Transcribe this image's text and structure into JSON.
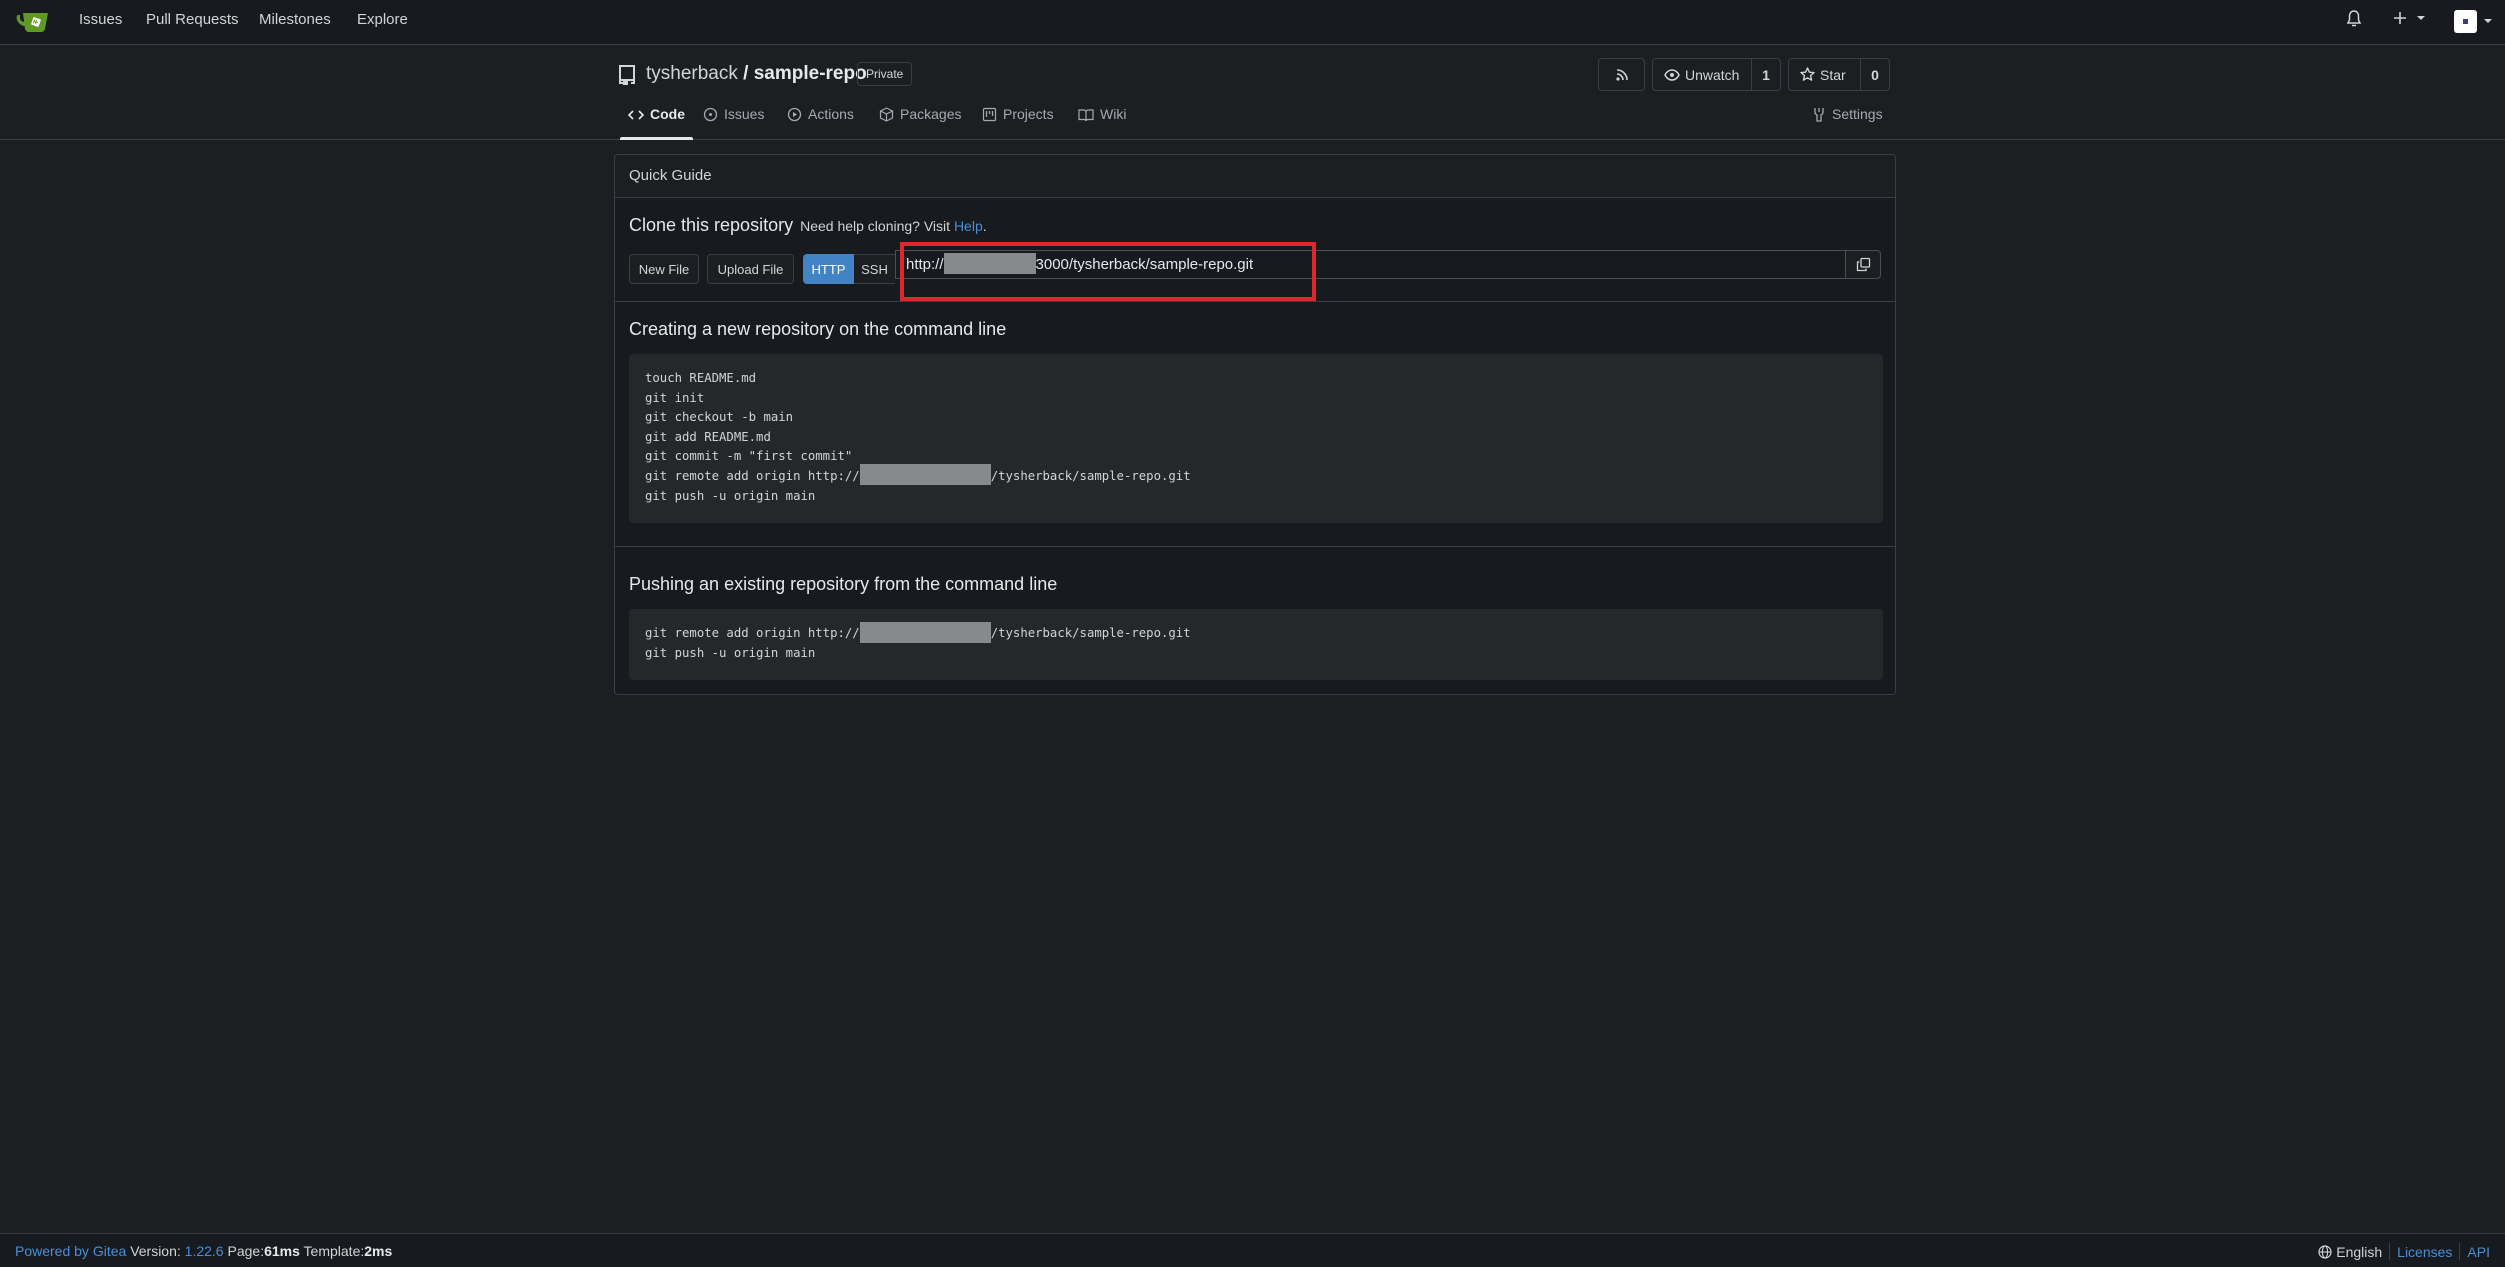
{
  "navbar": {
    "logo": "gitea-logo",
    "items": [
      {
        "label": "Issues"
      },
      {
        "label": "Pull Requests"
      },
      {
        "label": "Milestones"
      },
      {
        "label": "Explore"
      }
    ],
    "right_icons": [
      "bell-icon",
      "plus-icon",
      "avatar"
    ]
  },
  "repo": {
    "owner": "tysherback",
    "separator": "/",
    "name": "sample-repo",
    "visibility_badge": "Private",
    "rss_icon": "rss-icon",
    "watch": {
      "label": "Unwatch",
      "count": "1"
    },
    "star": {
      "label": "Star",
      "count": "0"
    },
    "tabs": [
      {
        "label": "Code",
        "icon": "code-icon",
        "active": true
      },
      {
        "label": "Issues",
        "icon": "issue-icon"
      },
      {
        "label": "Actions",
        "icon": "actions-play-icon"
      },
      {
        "label": "Packages",
        "icon": "package-icon"
      },
      {
        "label": "Projects",
        "icon": "project-icon"
      },
      {
        "label": "Wiki",
        "icon": "book-icon"
      }
    ],
    "settings_tab": {
      "label": "Settings",
      "icon": "tools-icon"
    }
  },
  "guide": {
    "title": "Quick Guide",
    "clone": {
      "title": "Clone this repository",
      "help_prefix": "Need help cloning? Visit ",
      "help_link": "Help",
      "help_suffix": ".",
      "new_file": "New File",
      "upload_file": "Upload File",
      "protocol_http": "HTTP",
      "protocol_ssh": "SSH",
      "selected_protocol": "HTTP",
      "url_prefix": "http://",
      "url_suffix": "3000/tysherback/sample-repo.git",
      "url_redacted": true,
      "highlight_color": "#e0252b"
    },
    "new_repo": {
      "title": "Creating a new repository on the command line",
      "lines": [
        "touch README.md",
        "git init",
        "git checkout -b main",
        "git add README.md",
        "git commit -m \"first commit\"",
        "git remote add origin http://",
        "git push -u origin main"
      ],
      "remote_suffix": "/tysherback/sample-repo.git"
    },
    "push_existing": {
      "title": "Pushing an existing repository from the command line",
      "line1_prefix": "git remote add origin http://",
      "line1_suffix": "/tysherback/sample-repo.git",
      "line2": "git push -u origin main"
    }
  },
  "footer": {
    "powered_by": "Powered by Gitea",
    "version_label": "Version:",
    "version": "1.22.6",
    "page_label": "Page:",
    "page_time": "61ms",
    "template_label": "Template:",
    "template_time": "2ms",
    "language": "English",
    "licenses": "Licenses",
    "api": "API"
  },
  "colors": {
    "accent": "#4183c4",
    "link": "#4a8fd8",
    "gitea_green": "#609926",
    "background": "#1c1e21"
  }
}
